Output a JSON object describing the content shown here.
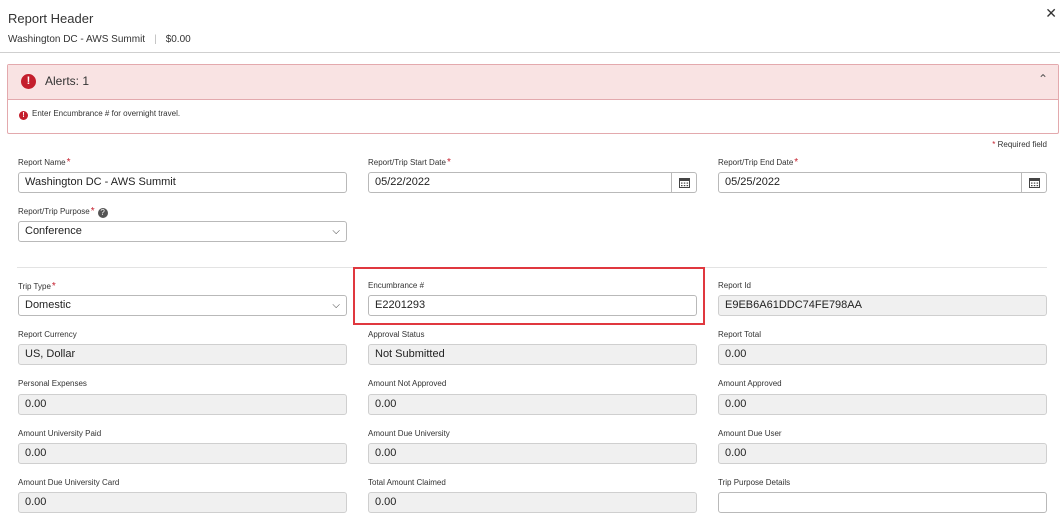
{
  "header": {
    "title": "Report Header",
    "report_name": "Washington DC - AWS Summit",
    "separator": "|",
    "amount": "$0.00",
    "close_icon": "close-icon"
  },
  "alerts": {
    "title": "Alerts: 1",
    "icon": "error-icon",
    "message": "Enter Encumbrance # for overnight travel.",
    "color": "#c41f2d"
  },
  "required_note": "Required field",
  "required_marker": "*",
  "form": {
    "report_name": {
      "label": "Report Name",
      "value": "Washington DC - AWS Summit"
    },
    "start_date": {
      "label": "Report/Trip Start Date",
      "value": "05/22/2022"
    },
    "end_date": {
      "label": "Report/Trip End Date",
      "value": "05/25/2022"
    },
    "trip_purpose": {
      "label": "Report/Trip Purpose",
      "value": "Conference"
    },
    "trip_type": {
      "label": "Trip Type",
      "value": "Domestic"
    },
    "encumbrance": {
      "label": "Encumbrance #",
      "value": "E2201293"
    },
    "report_id": {
      "label": "Report Id",
      "value": "E9EB6A61DDC74FE798AA"
    },
    "report_currency": {
      "label": "Report Currency",
      "value": "US, Dollar"
    },
    "approval_status": {
      "label": "Approval Status",
      "value": "Not Submitted"
    },
    "report_total": {
      "label": "Report Total",
      "value": "0.00"
    },
    "personal_expenses": {
      "label": "Personal Expenses",
      "value": "0.00"
    },
    "amount_not_approved": {
      "label": "Amount Not Approved",
      "value": "0.00"
    },
    "amount_approved": {
      "label": "Amount Approved",
      "value": "0.00"
    },
    "amount_university_paid": {
      "label": "Amount University Paid",
      "value": "0.00"
    },
    "amount_due_university": {
      "label": "Amount Due University",
      "value": "0.00"
    },
    "amount_due_user": {
      "label": "Amount Due User",
      "value": "0.00"
    },
    "amount_due_university_card": {
      "label": "Amount Due University Card",
      "value": "0.00"
    },
    "total_amount_claimed": {
      "label": "Total Amount Claimed",
      "value": "0.00"
    },
    "trip_purpose_details": {
      "label": "Trip Purpose Details",
      "value": ""
    }
  }
}
